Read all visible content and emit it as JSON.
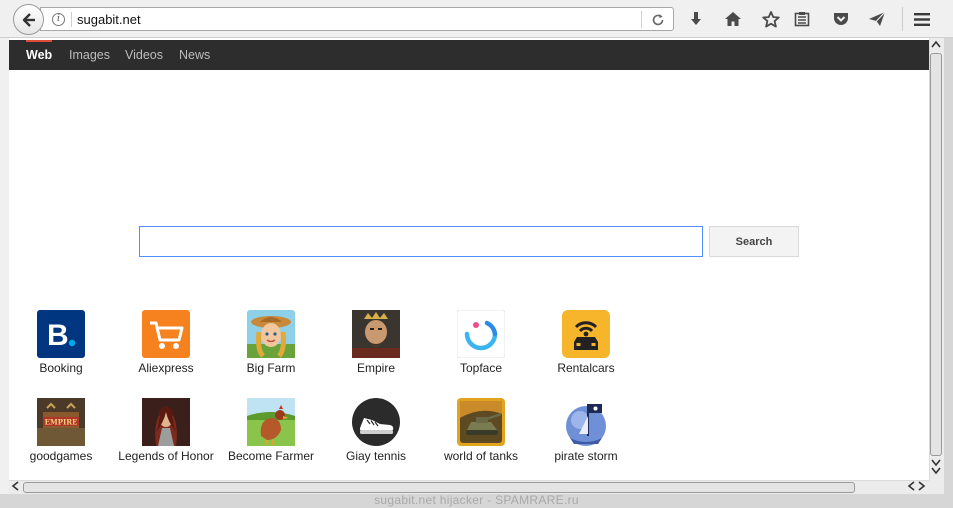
{
  "browser": {
    "url": "sugabit.net",
    "icons": {
      "back": "back-arrow-icon",
      "info": "info-icon",
      "reload": "reload-icon",
      "download": "download-icon",
      "home": "home-icon",
      "bookmark": "star-icon",
      "reader": "reading-list-icon",
      "pocket": "pocket-icon",
      "send": "send-icon",
      "menu": "hamburger-menu-icon"
    }
  },
  "nav": {
    "tabs": [
      {
        "label": "Web",
        "active": true
      },
      {
        "label": "Images",
        "active": false
      },
      {
        "label": "Videos",
        "active": false
      },
      {
        "label": "News",
        "active": false
      }
    ]
  },
  "search": {
    "value": "",
    "button_label": "Search"
  },
  "tiles": [
    {
      "label": "Booking",
      "icon": "booking-icon"
    },
    {
      "label": "Aliexpress",
      "icon": "shopping-cart-icon"
    },
    {
      "label": "Big Farm",
      "icon": "big-farm-icon"
    },
    {
      "label": "Empire",
      "icon": "empire-icon"
    },
    {
      "label": "Topface",
      "icon": "topface-icon"
    },
    {
      "label": "Rentalcars",
      "icon": "rentalcars-icon"
    },
    {
      "label": "goodgames",
      "icon": "goodgames-empire-icon"
    },
    {
      "label": "Legends of Honor",
      "icon": "legends-of-honor-icon"
    },
    {
      "label": "Become Farmer",
      "icon": "become-farmer-icon"
    },
    {
      "label": "Giay tennis",
      "icon": "sneaker-icon"
    },
    {
      "label": "world of tanks",
      "icon": "tank-icon"
    },
    {
      "label": "pirate storm",
      "icon": "pirate-ship-icon"
    }
  ],
  "watermark": "sugabit.net hijacker - SPAMRARE.ru",
  "colors": {
    "navbar": "#2d2d2d",
    "active_tab_indicator": "#dd4b39",
    "search_border": "#4d90fe",
    "booking": "#003580",
    "aliexpress": "#f5821f",
    "rentalcars": "#f7b52c"
  }
}
